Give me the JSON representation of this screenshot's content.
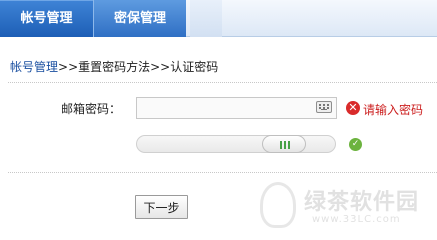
{
  "tabs": [
    {
      "label": "帐号管理",
      "active": true
    },
    {
      "label": "密保管理",
      "active": false
    }
  ],
  "breadcrumb": {
    "link": "帐号管理",
    "rest": ">>重置密码方法>>认证密码"
  },
  "form": {
    "label": "邮箱密码：",
    "value": "",
    "error": "请输入密码"
  },
  "icons": {
    "keyboard": "keyboard-icon",
    "error": "error-icon",
    "ok": "check-icon"
  },
  "next_button": "下一步",
  "watermark": {
    "text": "绿茶软件园",
    "url": "www.33LC.com"
  },
  "colors": {
    "tab_active": "#2366bd",
    "link": "#1a4fa0",
    "error": "#cc1f1f",
    "ok": "#6cb33e"
  }
}
